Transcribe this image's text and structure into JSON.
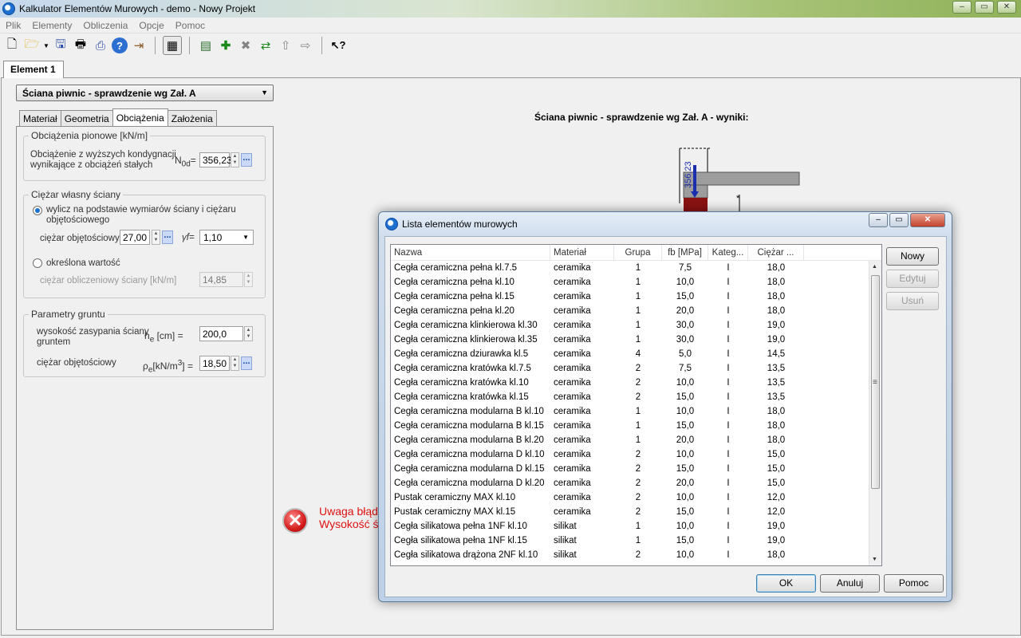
{
  "window": {
    "title": "Kalkulator Elementów Murowych - demo - Nowy Projekt"
  },
  "menu": [
    "Plik",
    "Elementy",
    "Obliczenia",
    "Opcje",
    "Pomoc"
  ],
  "document_tab": "Element 1",
  "element_type": "Ściana piwnic - sprawdzenie wg Zał. A",
  "tabs": [
    "Materiał",
    "Geometria",
    "Obciążenia",
    "Założenia"
  ],
  "active_tab": "Obciążenia",
  "vertical_loads": {
    "legend": "Obciążenia pionowe [kN/m]",
    "label_line1": "Obciążenie z wyższych kondygnacji",
    "label_line2": "wynikające z obciążeń stałych",
    "symbol": "N",
    "symbol_sub": "0d",
    "symbol_eq": "=",
    "value": "356,23"
  },
  "self_weight": {
    "legend": "Ciężar własny ściany",
    "radio1_line1": "wylicz na podstawie wymiarów ściany i ciężaru",
    "radio1_line2": "objętościowego",
    "unit_weight_label": "ciężar objętościowy",
    "unit_weight_value": "27,00",
    "gamma_symbol": "γf=",
    "gamma_value": "1,10",
    "radio2": "określona wartość",
    "calc_weight_label": "ciężar obliczeniowy ściany [kN/m]",
    "calc_weight_value": "14,85"
  },
  "soil": {
    "legend": "Parametry gruntu",
    "height_label_line1": "wysokość zasypania ściany",
    "height_label_line2": "gruntem",
    "height_symbol": "h",
    "height_sub": "e",
    "height_unit": " [cm] =",
    "height_value": "200,0",
    "density_label": "ciężar objętościowy",
    "density_symbol": "ρ",
    "density_sub": "e",
    "density_unit": "[kN/m",
    "density_sup": "3",
    "density_end": "] =",
    "density_value": "18,50"
  },
  "results_title": "Ściana piwnic - sprawdzenie wg Zał. A - wyniki:",
  "diagram_label": "356,23",
  "error": {
    "line1": "Uwaga błąd!",
    "line2": "Wysokość ś"
  },
  "dialog": {
    "title": "Lista elementów murowych",
    "columns": [
      "Nazwa",
      "Materiał",
      "Grupa",
      "fb [MPa]",
      "Kateg...",
      "Ciężar ..."
    ],
    "rows": [
      [
        "Cegła ceramiczna pełna kl.7.5",
        "ceramika",
        "1",
        "7,5",
        "I",
        "18,0"
      ],
      [
        "Cegła ceramiczna pełna kl.10",
        "ceramika",
        "1",
        "10,0",
        "I",
        "18,0"
      ],
      [
        "Cegła ceramiczna pełna kl.15",
        "ceramika",
        "1",
        "15,0",
        "I",
        "18,0"
      ],
      [
        "Cegła ceramiczna pełna kl.20",
        "ceramika",
        "1",
        "20,0",
        "I",
        "18,0"
      ],
      [
        "Cegła ceramiczna klinkierowa kl.30",
        "ceramika",
        "1",
        "30,0",
        "I",
        "19,0"
      ],
      [
        "Cegła ceramiczna klinkierowa kl.35",
        "ceramika",
        "1",
        "30,0",
        "I",
        "19,0"
      ],
      [
        "Cegła ceramiczna dziurawka kl.5",
        "ceramika",
        "4",
        "5,0",
        "I",
        "14,5"
      ],
      [
        "Cegła ceramiczna kratówka kl.7.5",
        "ceramika",
        "2",
        "7,5",
        "I",
        "13,5"
      ],
      [
        "Cegła ceramiczna kratówka kl.10",
        "ceramika",
        "2",
        "10,0",
        "I",
        "13,5"
      ],
      [
        "Cegła ceramiczna kratówka kl.15",
        "ceramika",
        "2",
        "15,0",
        "I",
        "13,5"
      ],
      [
        "Cegła ceramiczna modularna B kl.10",
        "ceramika",
        "1",
        "10,0",
        "I",
        "18,0"
      ],
      [
        "Cegła ceramiczna modularna B kl.15",
        "ceramika",
        "1",
        "15,0",
        "I",
        "18,0"
      ],
      [
        "Cegła ceramiczna modularna B kl.20",
        "ceramika",
        "1",
        "20,0",
        "I",
        "18,0"
      ],
      [
        "Cegła ceramiczna modularna D kl.10",
        "ceramika",
        "2",
        "10,0",
        "I",
        "15,0"
      ],
      [
        "Cegła ceramiczna modularna D kl.15",
        "ceramika",
        "2",
        "15,0",
        "I",
        "15,0"
      ],
      [
        "Cegła ceramiczna modularna D kl.20",
        "ceramika",
        "2",
        "20,0",
        "I",
        "15,0"
      ],
      [
        "Pustak ceramiczny MAX kl.10",
        "ceramika",
        "2",
        "10,0",
        "I",
        "12,0"
      ],
      [
        "Pustak ceramiczny MAX kl.15",
        "ceramika",
        "2",
        "15,0",
        "I",
        "12,0"
      ],
      [
        "Cegła silikatowa pełna 1NF kl.10",
        "silikat",
        "1",
        "10,0",
        "I",
        "19,0"
      ],
      [
        "Cegła silikatowa pełna 1NF kl.15",
        "silikat",
        "1",
        "15,0",
        "I",
        "19,0"
      ],
      [
        "Cegła silikatowa drążona 2NF kl.10",
        "silikat",
        "2",
        "10,0",
        "I",
        "18,0"
      ]
    ],
    "btn_new": "Nowy",
    "btn_edit": "Edytuj",
    "btn_delete": "Usuń",
    "btn_ok": "OK",
    "btn_cancel": "Anuluj",
    "btn_help": "Pomoc"
  }
}
